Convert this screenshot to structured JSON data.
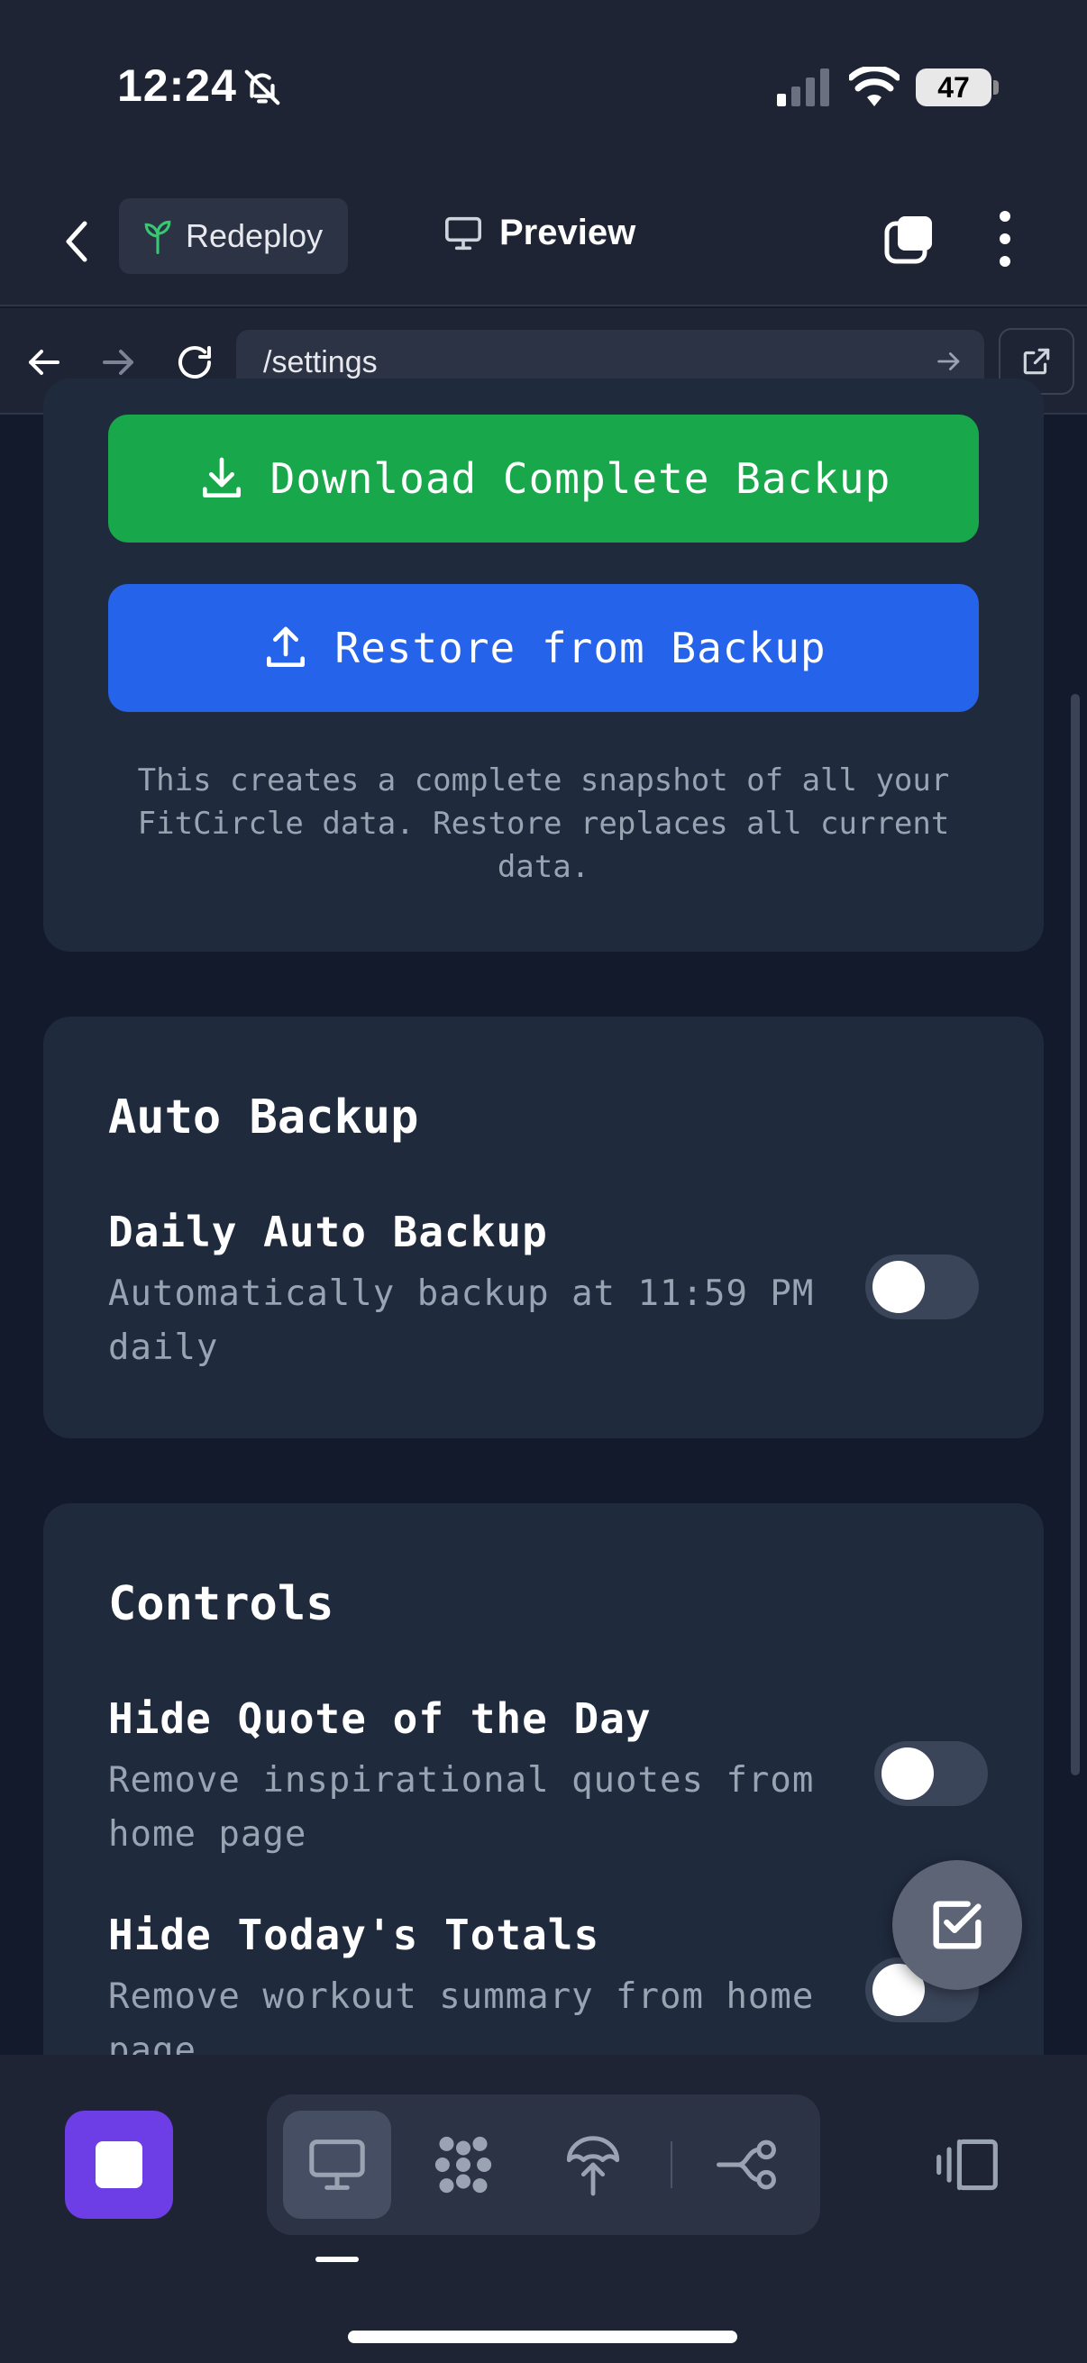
{
  "status_bar": {
    "time": "12:24",
    "battery": "47"
  },
  "header": {
    "redeploy_label": "Redeploy",
    "preview_label": "Preview"
  },
  "url_bar": {
    "url": "/settings"
  },
  "backup_card": {
    "download_label": "Download Complete Backup",
    "restore_label": "Restore from Backup",
    "note": "This creates a complete snapshot of all your FitCircle data. Restore replaces all current data."
  },
  "auto_backup_card": {
    "title": "Auto Backup",
    "setting_title": "Daily Auto Backup",
    "setting_desc": "Automatically backup at 11:59 PM daily",
    "enabled": false
  },
  "controls_card": {
    "title": "Controls",
    "items": [
      {
        "title": "Hide Quote of the Day",
        "desc": "Remove inspirational quotes from home page",
        "enabled": false
      },
      {
        "title": "Hide Today's Totals",
        "desc": "Remove workout summary from home page",
        "enabled": false
      }
    ]
  },
  "colors": {
    "download": "#18a84b",
    "restore": "#2563eb",
    "stop": "#6d3ee6",
    "card": "#1f2a3d",
    "background": "#121a2c"
  },
  "icons": [
    "bell-slash-icon",
    "signal-icon",
    "wifi-icon",
    "back-chevron-icon",
    "sprout-icon",
    "monitor-icon",
    "tabs-icon",
    "more-vertical-icon",
    "arrow-left-icon",
    "arrow-right-icon",
    "reload-icon",
    "external-link-icon",
    "download-icon",
    "upload-icon",
    "checkbox-icon",
    "stop-icon",
    "apps-icon",
    "deploy-icon",
    "share-icon",
    "panel-icon"
  ]
}
